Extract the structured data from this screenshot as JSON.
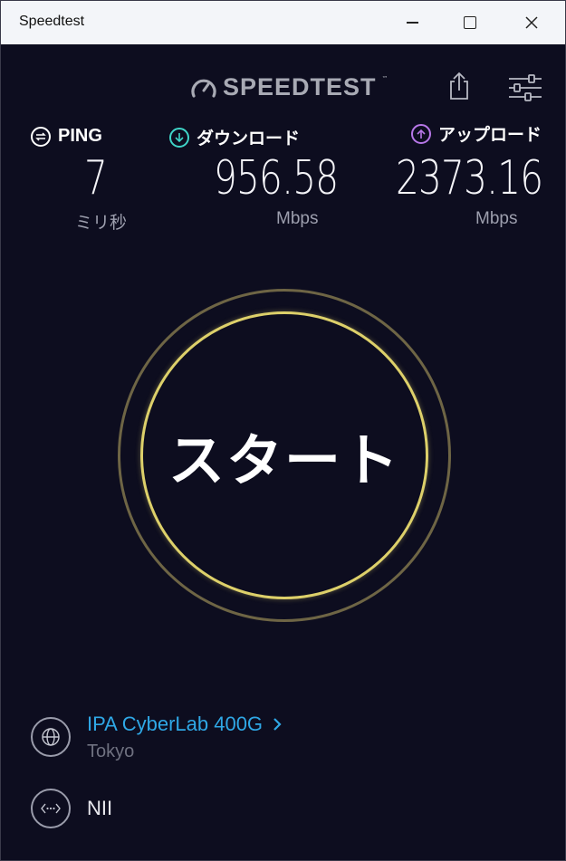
{
  "window": {
    "title": "Speedtest"
  },
  "header": {
    "logo_text": "SPEEDTEST",
    "logo_tm": "™"
  },
  "metrics": {
    "ping": {
      "label": "PING",
      "value": "7",
      "unit": "ミリ秒",
      "icon": "ping-icon",
      "color": "#ffffff"
    },
    "download": {
      "label": "ダウンロード",
      "value": "956.58",
      "unit": "Mbps",
      "icon": "download-arrow-icon",
      "color": "#3fd5c8"
    },
    "upload": {
      "label": "アップロード",
      "value": "2373.16",
      "unit": "Mbps",
      "icon": "upload-arrow-icon",
      "color": "#b777e8"
    }
  },
  "start": {
    "label": "スタート",
    "ring_color": "#ddd06a"
  },
  "server": {
    "name": "IPA CyberLab 400G",
    "location": "Tokyo",
    "name_color": "#2fa8e6"
  },
  "isp": {
    "name": "NII"
  }
}
